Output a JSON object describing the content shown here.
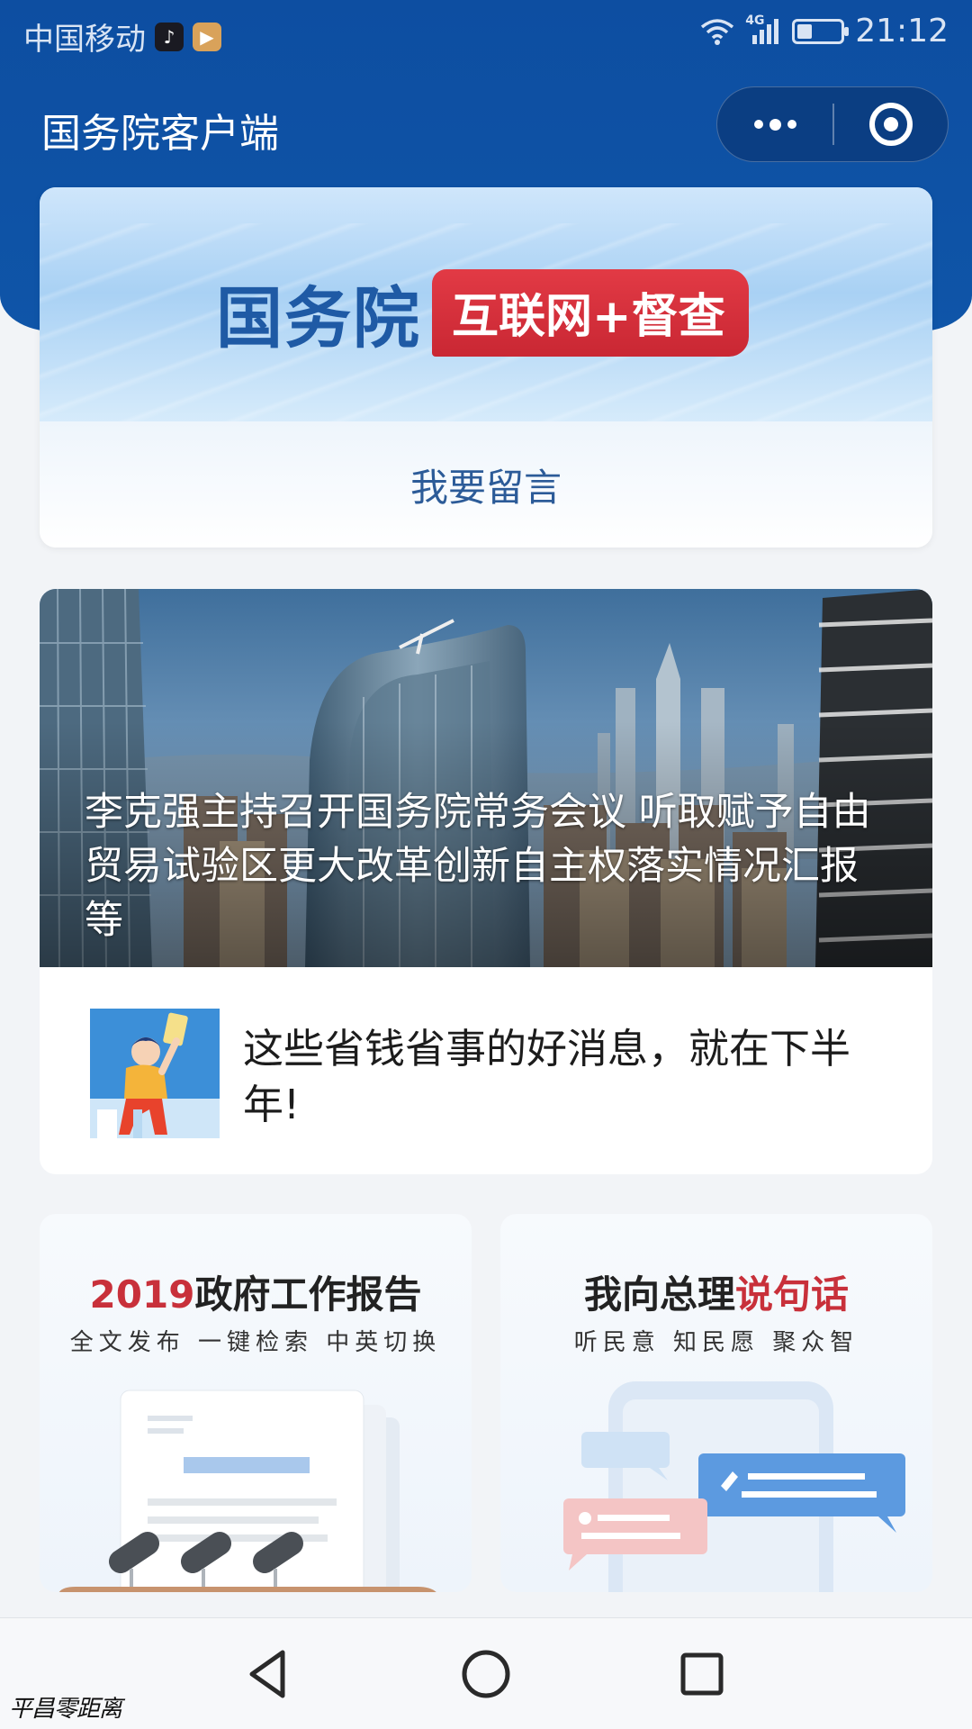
{
  "status_bar": {
    "carrier": "中国移动",
    "network": "4G",
    "battery_level": 0.35,
    "time": "21:12"
  },
  "nav": {
    "title": "国务院客户端"
  },
  "banner": {
    "logo_main": "国务院",
    "logo_tag": "互联网+督查",
    "action": "我要留言"
  },
  "news": {
    "headline": "李克强主持召开国务院常务会议 听取赋予自由贸易试验区更大改革创新自主权落实情况汇报等",
    "item_title": "这些省钱省事的好消息，就在下半年!"
  },
  "features": [
    {
      "title_accent": "2019",
      "title_rest": "政府工作报告",
      "subtitle": "全文发布 一键检索 中英切换"
    },
    {
      "title_rest": "我向总理",
      "title_accent": "说句话",
      "subtitle": "听民意 知民愿 聚众智"
    }
  ],
  "watermark": "平昌零距离",
  "colors": {
    "header_blue": "#0f55a8",
    "accent_red": "#c8303a",
    "logo_blue": "#1f5aa5"
  }
}
